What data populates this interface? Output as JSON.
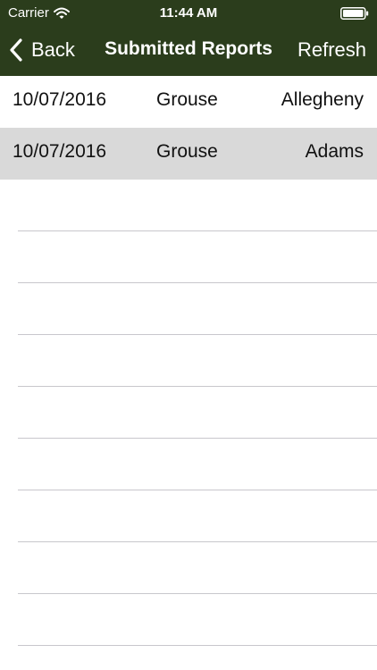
{
  "status_bar": {
    "carrier": "Carrier",
    "time": "11:44 AM",
    "wifi_icon": "wifi-icon",
    "battery_icon": "battery-icon"
  },
  "nav_bar": {
    "back_label": "Back",
    "back_icon": "chevron-left-icon",
    "title": "Submitted Reports",
    "refresh_label": "Refresh",
    "background_color": "#2b3d1c",
    "text_color": "#ffffff"
  },
  "reports": [
    {
      "date": "10/07/2016",
      "species": "Grouse",
      "county": "Allegheny",
      "selected": false
    },
    {
      "date": "10/07/2016",
      "species": "Grouse",
      "county": "Adams",
      "selected": true
    }
  ],
  "colors": {
    "selected_row": "#d9d9d9",
    "separator": "#c8c7cc"
  }
}
